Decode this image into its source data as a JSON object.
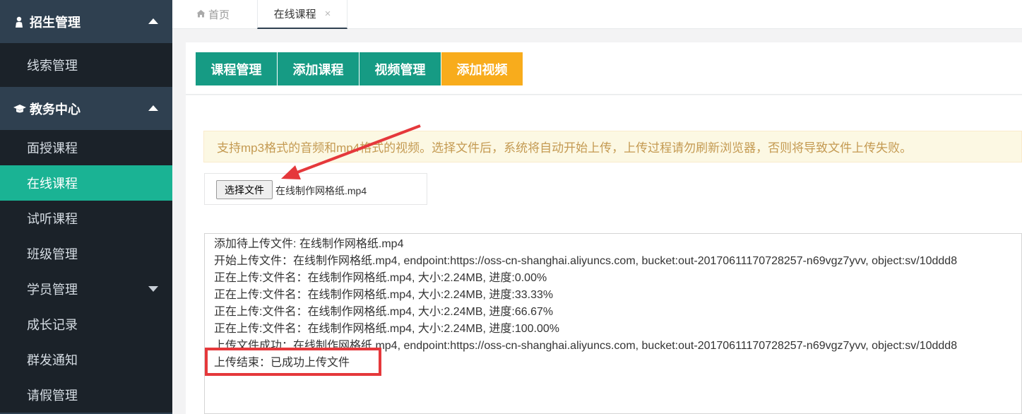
{
  "sidebar": {
    "group1": {
      "label": "招生管理",
      "icon": "person-icon"
    },
    "group1_items": [
      {
        "label": "线索管理"
      }
    ],
    "group2": {
      "label": "教务中心",
      "icon": "graduation-cap-icon"
    },
    "group2_items": [
      {
        "label": "面授课程"
      },
      {
        "label": "在线课程",
        "active": true
      },
      {
        "label": "试听课程"
      },
      {
        "label": "班级管理"
      },
      {
        "label": "学员管理",
        "has_submenu": true
      },
      {
        "label": "成长记录"
      },
      {
        "label": "群发通知"
      },
      {
        "label": "请假管理"
      }
    ]
  },
  "tabs": {
    "home": {
      "label": "首页",
      "icon": "home-icon"
    },
    "current": {
      "label": "在线课程",
      "close": "×"
    }
  },
  "buttons": {
    "course_manage": "课程管理",
    "add_course": "添加课程",
    "video_manage": "视频管理",
    "add_video": "添加视频"
  },
  "alert_text": "支持mp3格式的音频和mp4格式的视频。选择文件后，系统将自动开始上传，上传过程请勿刷新浏览器，否则将导致文件上传失败。",
  "file_input": {
    "button_label": "选择文件",
    "file_name": "在线制作网格纸.mp4"
  },
  "log_lines": [
    "添加待上传文件: 在线制作网格纸.mp4",
    "开始上传文件：在线制作网格纸.mp4, endpoint:https://oss-cn-shanghai.aliyuncs.com, bucket:out-20170611170728257-n69vgz7yvv, object:sv/10ddd8",
    "正在上传:文件名：在线制作网格纸.mp4, 大小:2.24MB, 进度:0.00%",
    "正在上传:文件名：在线制作网格纸.mp4, 大小:2.24MB, 进度:33.33%",
    "正在上传:文件名：在线制作网格纸.mp4, 大小:2.24MB, 进度:66.67%",
    "正在上传:文件名：在线制作网格纸.mp4, 大小:2.24MB, 进度:100.00%",
    "上传文件成功：在线制作网格纸.mp4, endpoint:https://oss-cn-shanghai.aliyuncs.com, bucket:out-20170611170728257-n69vgz7yvv, object:sv/10ddd8",
    "上传结束：已成功上传文件"
  ],
  "colors": {
    "sidebar_bg": "#2f4050",
    "active_item": "#1ab394",
    "teal_button": "#169b84",
    "yellow_button": "#f8ac1c",
    "annotation_red": "#e5383b"
  }
}
